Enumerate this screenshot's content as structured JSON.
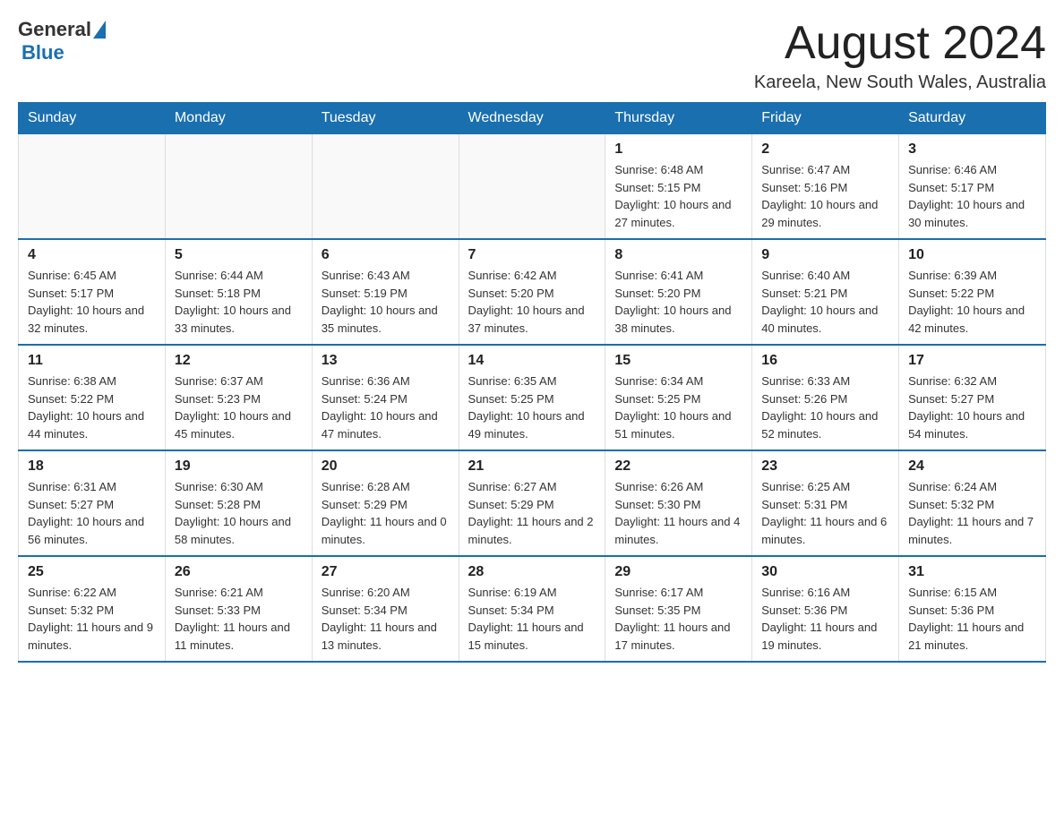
{
  "header": {
    "logo_general": "General",
    "logo_blue": "Blue",
    "month_title": "August 2024",
    "location": "Kareela, New South Wales, Australia"
  },
  "weekdays": [
    "Sunday",
    "Monday",
    "Tuesday",
    "Wednesday",
    "Thursday",
    "Friday",
    "Saturday"
  ],
  "weeks": [
    [
      {
        "day": "",
        "info": ""
      },
      {
        "day": "",
        "info": ""
      },
      {
        "day": "",
        "info": ""
      },
      {
        "day": "",
        "info": ""
      },
      {
        "day": "1",
        "info": "Sunrise: 6:48 AM\nSunset: 5:15 PM\nDaylight: 10 hours and 27 minutes."
      },
      {
        "day": "2",
        "info": "Sunrise: 6:47 AM\nSunset: 5:16 PM\nDaylight: 10 hours and 29 minutes."
      },
      {
        "day": "3",
        "info": "Sunrise: 6:46 AM\nSunset: 5:17 PM\nDaylight: 10 hours and 30 minutes."
      }
    ],
    [
      {
        "day": "4",
        "info": "Sunrise: 6:45 AM\nSunset: 5:17 PM\nDaylight: 10 hours and 32 minutes."
      },
      {
        "day": "5",
        "info": "Sunrise: 6:44 AM\nSunset: 5:18 PM\nDaylight: 10 hours and 33 minutes."
      },
      {
        "day": "6",
        "info": "Sunrise: 6:43 AM\nSunset: 5:19 PM\nDaylight: 10 hours and 35 minutes."
      },
      {
        "day": "7",
        "info": "Sunrise: 6:42 AM\nSunset: 5:20 PM\nDaylight: 10 hours and 37 minutes."
      },
      {
        "day": "8",
        "info": "Sunrise: 6:41 AM\nSunset: 5:20 PM\nDaylight: 10 hours and 38 minutes."
      },
      {
        "day": "9",
        "info": "Sunrise: 6:40 AM\nSunset: 5:21 PM\nDaylight: 10 hours and 40 minutes."
      },
      {
        "day": "10",
        "info": "Sunrise: 6:39 AM\nSunset: 5:22 PM\nDaylight: 10 hours and 42 minutes."
      }
    ],
    [
      {
        "day": "11",
        "info": "Sunrise: 6:38 AM\nSunset: 5:22 PM\nDaylight: 10 hours and 44 minutes."
      },
      {
        "day": "12",
        "info": "Sunrise: 6:37 AM\nSunset: 5:23 PM\nDaylight: 10 hours and 45 minutes."
      },
      {
        "day": "13",
        "info": "Sunrise: 6:36 AM\nSunset: 5:24 PM\nDaylight: 10 hours and 47 minutes."
      },
      {
        "day": "14",
        "info": "Sunrise: 6:35 AM\nSunset: 5:25 PM\nDaylight: 10 hours and 49 minutes."
      },
      {
        "day": "15",
        "info": "Sunrise: 6:34 AM\nSunset: 5:25 PM\nDaylight: 10 hours and 51 minutes."
      },
      {
        "day": "16",
        "info": "Sunrise: 6:33 AM\nSunset: 5:26 PM\nDaylight: 10 hours and 52 minutes."
      },
      {
        "day": "17",
        "info": "Sunrise: 6:32 AM\nSunset: 5:27 PM\nDaylight: 10 hours and 54 minutes."
      }
    ],
    [
      {
        "day": "18",
        "info": "Sunrise: 6:31 AM\nSunset: 5:27 PM\nDaylight: 10 hours and 56 minutes."
      },
      {
        "day": "19",
        "info": "Sunrise: 6:30 AM\nSunset: 5:28 PM\nDaylight: 10 hours and 58 minutes."
      },
      {
        "day": "20",
        "info": "Sunrise: 6:28 AM\nSunset: 5:29 PM\nDaylight: 11 hours and 0 minutes."
      },
      {
        "day": "21",
        "info": "Sunrise: 6:27 AM\nSunset: 5:29 PM\nDaylight: 11 hours and 2 minutes."
      },
      {
        "day": "22",
        "info": "Sunrise: 6:26 AM\nSunset: 5:30 PM\nDaylight: 11 hours and 4 minutes."
      },
      {
        "day": "23",
        "info": "Sunrise: 6:25 AM\nSunset: 5:31 PM\nDaylight: 11 hours and 6 minutes."
      },
      {
        "day": "24",
        "info": "Sunrise: 6:24 AM\nSunset: 5:32 PM\nDaylight: 11 hours and 7 minutes."
      }
    ],
    [
      {
        "day": "25",
        "info": "Sunrise: 6:22 AM\nSunset: 5:32 PM\nDaylight: 11 hours and 9 minutes."
      },
      {
        "day": "26",
        "info": "Sunrise: 6:21 AM\nSunset: 5:33 PM\nDaylight: 11 hours and 11 minutes."
      },
      {
        "day": "27",
        "info": "Sunrise: 6:20 AM\nSunset: 5:34 PM\nDaylight: 11 hours and 13 minutes."
      },
      {
        "day": "28",
        "info": "Sunrise: 6:19 AM\nSunset: 5:34 PM\nDaylight: 11 hours and 15 minutes."
      },
      {
        "day": "29",
        "info": "Sunrise: 6:17 AM\nSunset: 5:35 PM\nDaylight: 11 hours and 17 minutes."
      },
      {
        "day": "30",
        "info": "Sunrise: 6:16 AM\nSunset: 5:36 PM\nDaylight: 11 hours and 19 minutes."
      },
      {
        "day": "31",
        "info": "Sunrise: 6:15 AM\nSunset: 5:36 PM\nDaylight: 11 hours and 21 minutes."
      }
    ]
  ]
}
